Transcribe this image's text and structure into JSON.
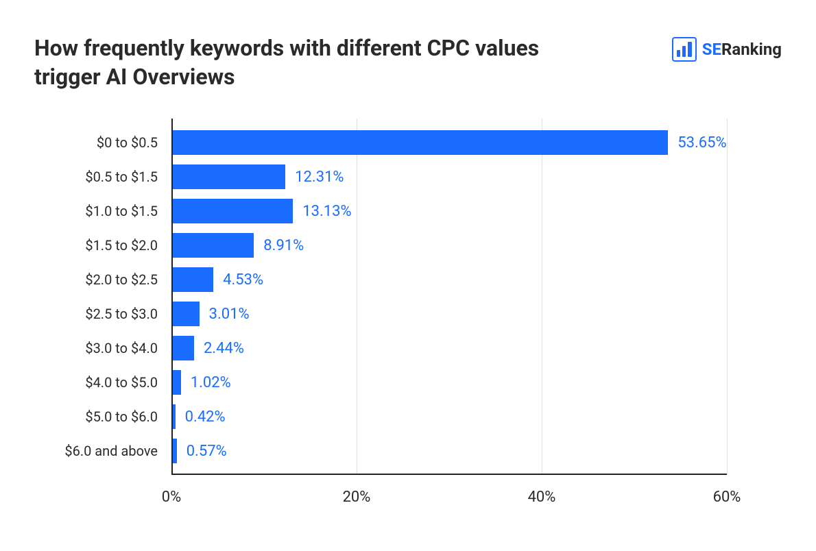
{
  "title": "How frequently keywords with different CPC values trigger AI Overviews",
  "brand": {
    "se": "SE",
    "ranking": "Ranking"
  },
  "chart_data": {
    "type": "bar",
    "orientation": "horizontal",
    "categories": [
      "$0 to $0.5",
      "$0.5 to $1.5",
      "$1.0 to $1.5",
      "$1.5 to $2.0",
      "$2.0 to $2.5",
      "$2.5 to $3.0",
      "$3.0 to $4.0",
      "$4.0 to $5.0",
      "$5.0 to $6.0",
      "$6.0 and above"
    ],
    "values": [
      53.65,
      12.31,
      13.13,
      8.91,
      4.53,
      3.01,
      2.44,
      1.02,
      0.42,
      0.57
    ],
    "value_labels": [
      "53.65%",
      "12.31%",
      "13.13%",
      "8.91%",
      "4.53%",
      "3.01%",
      "2.44%",
      "1.02%",
      "0.42%",
      "0.57%"
    ],
    "xlabel": "",
    "ylabel": "",
    "xlim": [
      0,
      60
    ],
    "x_ticks": [
      0,
      20,
      40,
      60
    ],
    "x_tick_labels": [
      "0%",
      "20%",
      "40%",
      "60%"
    ],
    "bar_color": "#1a6dff",
    "grid": true
  }
}
